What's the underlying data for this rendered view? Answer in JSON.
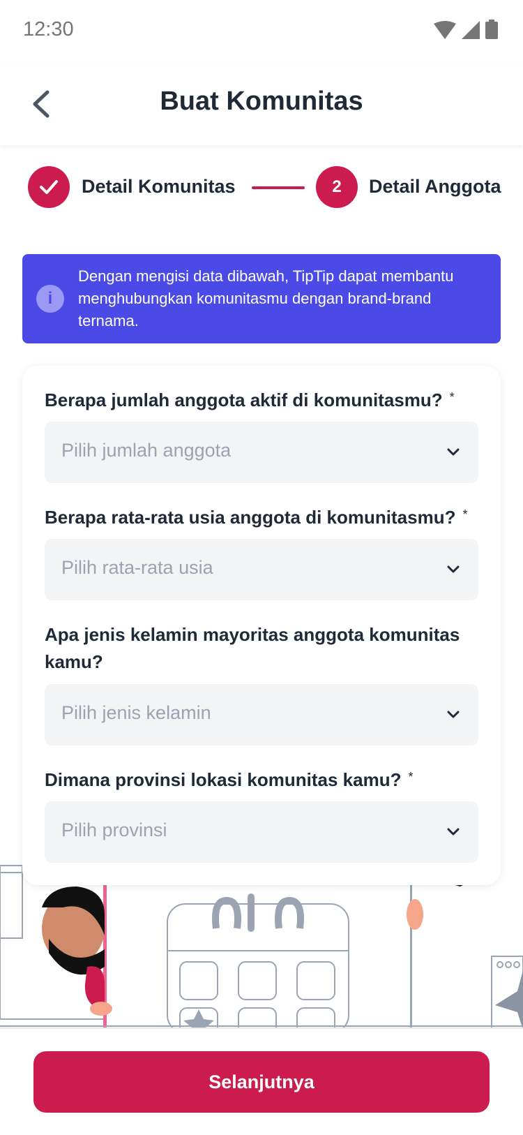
{
  "status_bar": {
    "time": "12:30",
    "icons": [
      "wifi-icon",
      "signal-icon",
      "battery-icon"
    ]
  },
  "header": {
    "title": "Buat Komunitas",
    "back_icon": "chevron-left-icon"
  },
  "stepper": {
    "steps": [
      {
        "label": "Detail Komunitas",
        "state": "completed",
        "marker": "check-icon"
      },
      {
        "label": "Detail Anggota",
        "state": "active",
        "number": "2"
      }
    ],
    "accent_color": "#cc1c4f"
  },
  "info_banner": {
    "text": "Dengan mengisi data dibawah, TipTip dapat membantu menghubungkan komunitasmu dengan brand-brand ternama.",
    "icon": "info-icon",
    "color": "#4c4ae6"
  },
  "form": {
    "fields": [
      {
        "label": "Berapa jumlah anggota aktif  di komunitasmu?",
        "required_mark": "*",
        "placeholder": "Pilih jumlah anggota"
      },
      {
        "label": "Berapa rata-rata usia anggota di komunitasmu?",
        "required_mark": "*",
        "placeholder": "Pilih rata-rata usia"
      },
      {
        "label": "Apa jenis kelamin mayoritas anggota komunitas kamu?",
        "required_mark": "",
        "placeholder": "Pilih jenis kelamin"
      },
      {
        "label": "Dimana provinsi lokasi komunitas kamu?",
        "required_mark": "*",
        "placeholder": "Pilih provinsi"
      }
    ]
  },
  "footer": {
    "next_label": "Selanjutnya"
  }
}
